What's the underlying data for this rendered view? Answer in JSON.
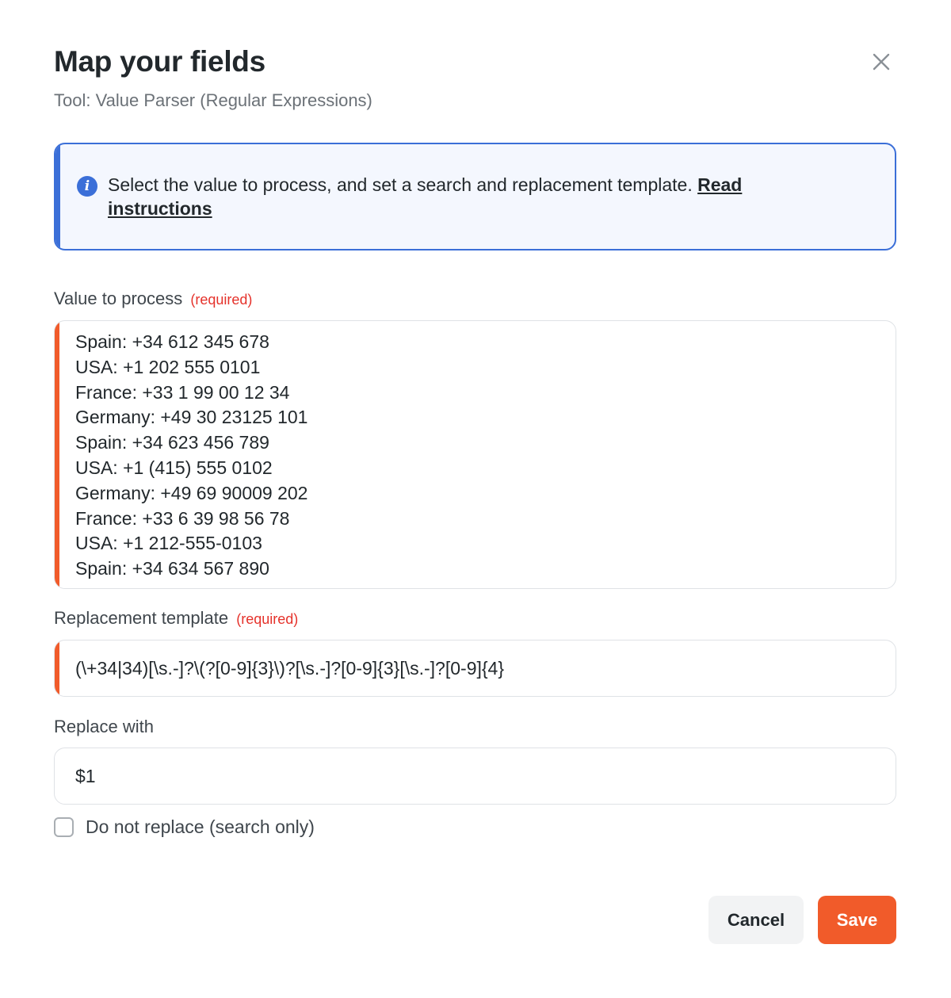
{
  "dialog": {
    "title": "Map your fields",
    "subtitle": "Tool: Value Parser (Regular Expressions)",
    "close_icon": "close-icon"
  },
  "info": {
    "icon": "info-icon",
    "text": "Select the value to process, and set a search and replacement template. ",
    "link_label": "Read instructions"
  },
  "value_to_process": {
    "label": "Value to process",
    "required": "(required)",
    "lines": [
      "Spain: +34 612 345 678",
      "USA: +1 202 555 0101",
      "France: +33 1 99 00 12 34",
      "Germany: +49 30 23125 101",
      "Spain: +34 623 456 789",
      "USA: +1 (415) 555 0102",
      "Germany: +49 69 90009 202",
      "France: +33 6 39 98 56 78",
      "USA: +1 212-555-0103",
      "Spain: +34 634 567 890"
    ]
  },
  "replacement_template": {
    "label": "Replacement template",
    "required": "(required)",
    "value": "(\\+34|34)[\\s.-]?\\(?[0-9]{3}\\)?[\\s.-]?[0-9]{3}[\\s.-]?[0-9]{4}"
  },
  "replace_with": {
    "label": "Replace with",
    "value": "$1"
  },
  "search_only": {
    "label": "Do not replace (search only)",
    "checked": false
  },
  "buttons": {
    "cancel": "Cancel",
    "save": "Save"
  },
  "colors": {
    "accent": "#f15b2a",
    "info_border": "#3b6fd8",
    "info_bg": "#f4f7fe",
    "required": "#e5322b"
  }
}
